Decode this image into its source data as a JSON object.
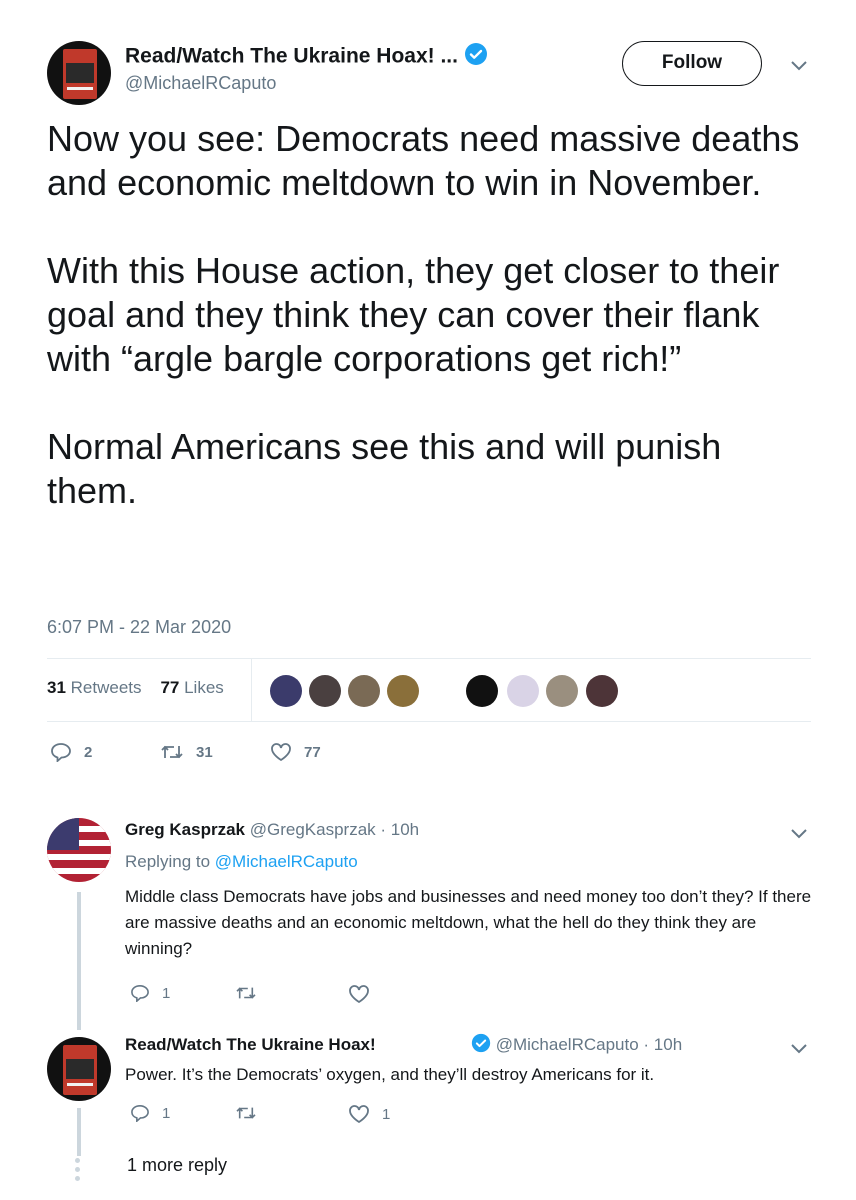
{
  "tweet": {
    "author_name": "Read/Watch The Ukraine Hoax! ...",
    "author_handle": "@MichaelRCaputo",
    "follow_label": "Follow",
    "paragraphs": [
      "Now you see: Democrats need massive deaths and economic meltdown to win in November.",
      "With this House action, they get closer to their goal and they think they can cover their flank with “argle bargle corporations get rich!”",
      "Normal Americans see this and will punish them."
    ],
    "timestamp": "6:07 PM - 22 Mar 2020",
    "retweets_count": "31",
    "retweets_label": "Retweets",
    "likes_count": "77",
    "likes_label": "Likes",
    "reply_action_count": "2",
    "retweet_action_count": "31",
    "like_action_count": "77"
  },
  "replies": [
    {
      "author_name": "Greg Kasprzak",
      "author_handle": "@GregKasprzak",
      "time": "· 10h",
      "replying_prefix": "Replying to",
      "replying_to": "@MichaelRCaputo",
      "text": "Middle class Democrats have jobs and businesses and need money too don’t they? If there are massive deaths and an economic meltdown, what the hell do they think they are winning?",
      "reply_count": "1",
      "retweet_count": "",
      "like_count": ""
    },
    {
      "author_name": "Read/Watch The Ukraine Hoax!",
      "author_handle": "@MichaelRCaputo",
      "time": "· 10h",
      "text": "Power. It’s the Democrats’ oxygen, and they’ll destroy Americans for it.",
      "reply_count": "1",
      "retweet_count": "",
      "like_count": "1"
    }
  ],
  "more_replies_label": "1 more reply",
  "colors": {
    "verified": "#1da1f2",
    "link": "#1da1f2",
    "secondary_text": "#657786",
    "divider": "#e6ecf0"
  },
  "icons": [
    "verified-badge-icon",
    "chevron-down-icon",
    "reply-icon",
    "retweet-icon",
    "like-icon"
  ]
}
